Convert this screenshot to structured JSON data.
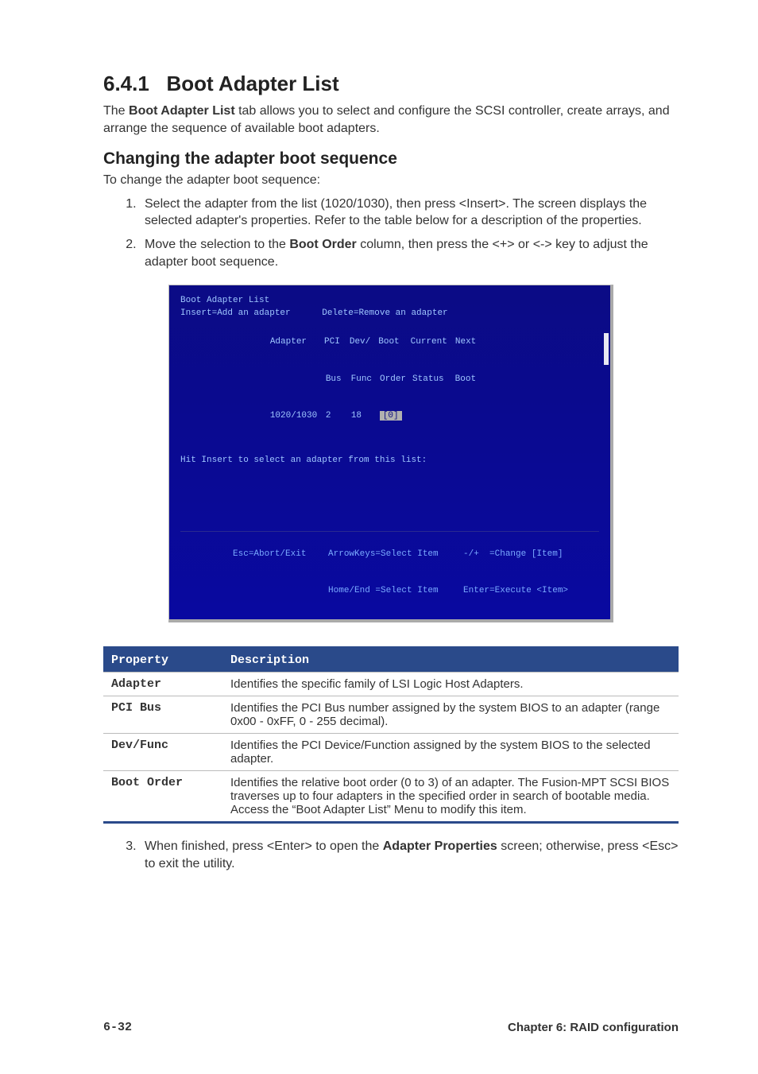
{
  "section": {
    "number": "6.4.1",
    "title": "Boot Adapter List"
  },
  "intro": {
    "prefix": "The ",
    "bold": "Boot Adapter List",
    "rest": " tab allows you to select and configure the SCSI controller, create arrays, and arrange the sequence of available boot adapters."
  },
  "subhead": "Changing the adapter boot sequence",
  "subintro": "To change the adapter boot sequence:",
  "steps": {
    "s1": "Select the adapter from the list (1020/1030), then press <Insert>. The screen displays the selected adapter's properties. Refer to the table below for a description of the properties.",
    "s2_pre": "Move the selection to the ",
    "s2_bold": "Boot Order",
    "s2_post": " column, then press the <+> or <-> key to adjust the adapter boot sequence.",
    "s3_pre": "When finished, press <Enter> to open the ",
    "s3_bold": "Adapter Properties",
    "s3_post": " screen; otherwise, press <Esc> to exit the utility."
  },
  "bios": {
    "title": "Boot Adapter List",
    "line1_left": "Insert=Add an adapter",
    "line1_right": "Delete=Remove an adapter",
    "hdr": {
      "adapter": "Adapter",
      "pci": "PCI",
      "bus": "Bus",
      "dev": "Dev/",
      "func": "Func",
      "boot": "Boot",
      "order": "Order",
      "current": "Current",
      "status": "Status",
      "next": "Next",
      "nboot": "Boot"
    },
    "row": {
      "adapter": "1020/1030",
      "bus": "2",
      "func": "18",
      "order": "[0]"
    },
    "hint": "Hit Insert to select an adapter from this list:",
    "keys": {
      "esc": "Esc=Abort/Exit",
      "arrow": "ArrowKeys=Select Item",
      "homeend": "Home/End =Select Item",
      "plusminus": "-/+  =Change [Item]",
      "enter": "Enter=Execute <Item>"
    }
  },
  "table": {
    "head": {
      "prop": "Property",
      "desc": "Description"
    },
    "rows": [
      {
        "prop": "Adapter",
        "desc": "Identifies the specific family of LSI Logic Host Adapters."
      },
      {
        "prop": "PCI Bus",
        "desc": "Identifies the PCI Bus number assigned by the system BIOS to an adapter (range 0x00 - 0xFF, 0 - 255 decimal)."
      },
      {
        "prop": "Dev/Func",
        "desc": "Identifies the PCI Device/Function assigned by the system BIOS to the selected adapter."
      },
      {
        "prop": "Boot Order",
        "desc": "Identifies the relative boot order (0 to 3) of an adapter. The Fusion-MPT SCSI BIOS traverses up to four adapters in the specified order in search of bootable media. Access the “Boot Adapter List” Menu to modify this item."
      }
    ]
  },
  "footer": {
    "left": "6-32",
    "right": "Chapter 6: RAID configuration"
  }
}
